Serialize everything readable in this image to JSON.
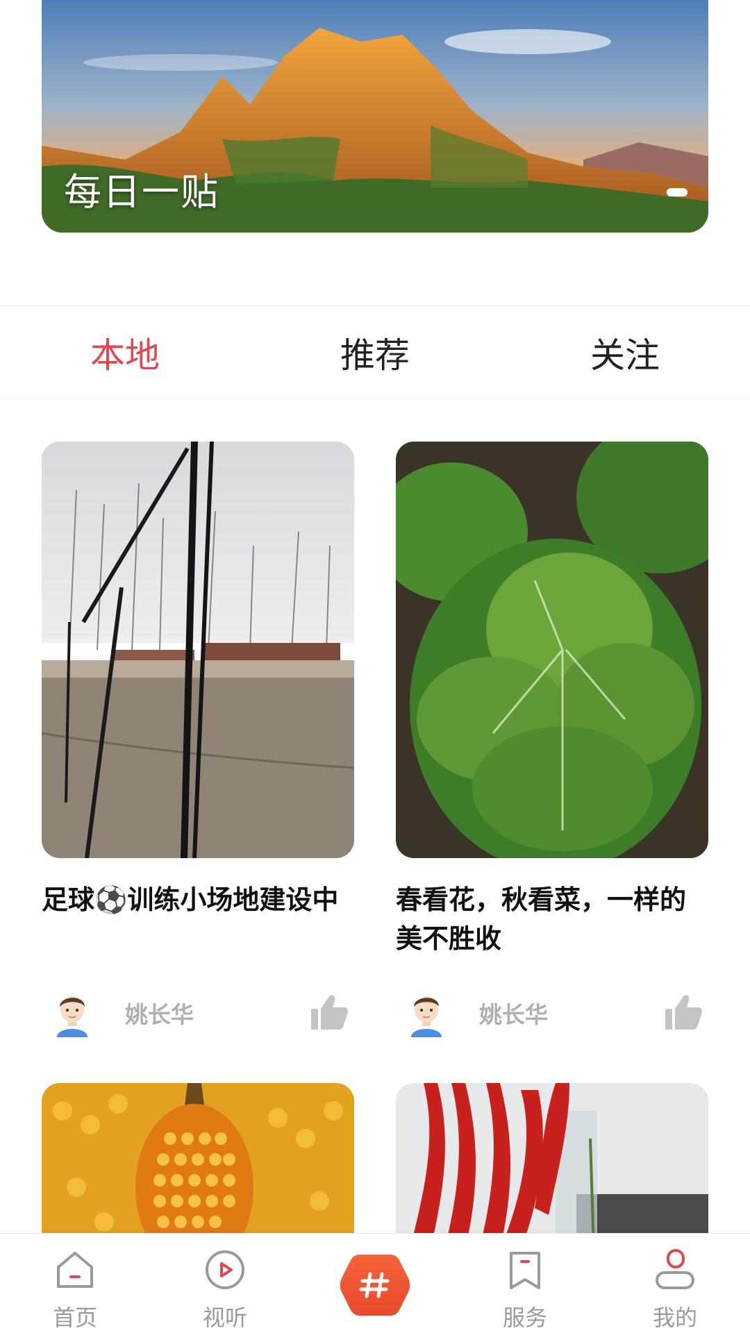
{
  "banner": {
    "title": "每日一贴"
  },
  "tabs": [
    {
      "label": "本地",
      "active": true
    },
    {
      "label": "推荐",
      "active": false
    },
    {
      "label": "关注",
      "active": false
    }
  ],
  "feed": [
    {
      "title": "足球⚽训练小场地建设中",
      "author": "姚长华"
    },
    {
      "title": "春看花，秋看菜，一样的美不胜收",
      "author": "姚长华"
    }
  ],
  "bottom_nav": {
    "items": [
      {
        "label": "首页",
        "icon": "home-icon"
      },
      {
        "label": "视听",
        "icon": "play-icon"
      },
      {
        "label": "",
        "icon": "hash-icon"
      },
      {
        "label": "服务",
        "icon": "bookmark-icon"
      },
      {
        "label": "我的",
        "icon": "user-icon"
      }
    ]
  },
  "colors": {
    "accent": "#e0484e",
    "hash_gradient_start": "#f5633a",
    "hash_gradient_end": "#e84a2e",
    "muted": "#9a9a9a"
  }
}
